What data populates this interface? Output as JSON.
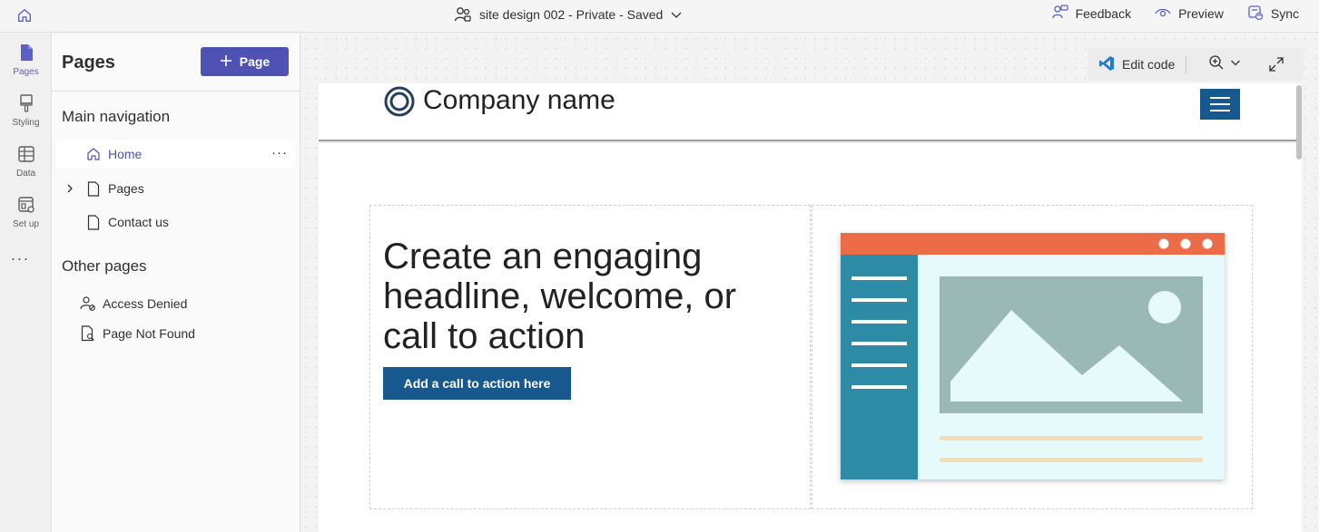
{
  "topbar": {
    "title": "site design 002 - Private - Saved",
    "actions": [
      {
        "label": "Feedback",
        "icon": "feedback-icon"
      },
      {
        "label": "Preview",
        "icon": "preview-eye-icon"
      },
      {
        "label": "Sync",
        "icon": "sync-icon"
      }
    ]
  },
  "rail": {
    "items": [
      {
        "label": "Pages",
        "icon": "pages-icon",
        "active": true
      },
      {
        "label": "Styling",
        "icon": "styling-brush-icon",
        "active": false
      },
      {
        "label": "Data",
        "icon": "data-table-icon",
        "active": false
      },
      {
        "label": "Set up",
        "icon": "setup-icon",
        "active": false
      }
    ],
    "more": "···"
  },
  "panel": {
    "title": "Pages",
    "add_button": "Page",
    "main_nav_title": "Main navigation",
    "main_nav": [
      {
        "label": "Home",
        "icon": "home-icon",
        "active": true
      },
      {
        "label": "Pages",
        "icon": "page-icon",
        "expandable": true
      },
      {
        "label": "Contact us",
        "icon": "page-icon"
      }
    ],
    "other_title": "Other pages",
    "other_pages": [
      {
        "label": "Access Denied",
        "icon": "person-lock-icon"
      },
      {
        "label": "Page Not Found",
        "icon": "page-search-icon"
      }
    ],
    "more": "···"
  },
  "canvas": {
    "edit_code": "Edit code",
    "site": {
      "company_name": "Company name",
      "headline": "Create an engaging headline, welcome, or call to action",
      "cta": "Add a call to action here"
    }
  },
  "colors": {
    "accent": "#4f52b2",
    "site_primary": "#17588f",
    "illus_header": "#ec6c47",
    "illus_sidebar": "#2e8ba6",
    "illus_body": "#e6f9fb",
    "illus_image": "#9ab9b4",
    "illus_line": "#f5deb4"
  }
}
